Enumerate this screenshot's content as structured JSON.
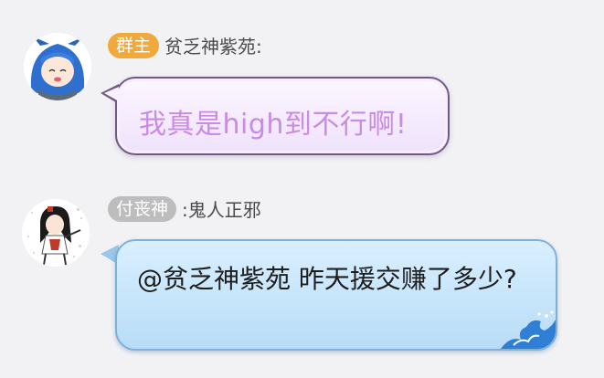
{
  "messages": [
    {
      "badge": "群主",
      "badge_color": "#f2a93b",
      "sender": "贫乏神紫苑:",
      "text": "我真是high到不行啊!",
      "avatar": "avatar-blue-hair-girl"
    },
    {
      "badge": "付丧神",
      "badge_color": "#bdbdbd",
      "sender": ":鬼人正邪",
      "text": "@贫乏神紫苑 昨天援交赚了多少?",
      "avatar": "avatar-black-hair-girl"
    }
  ]
}
